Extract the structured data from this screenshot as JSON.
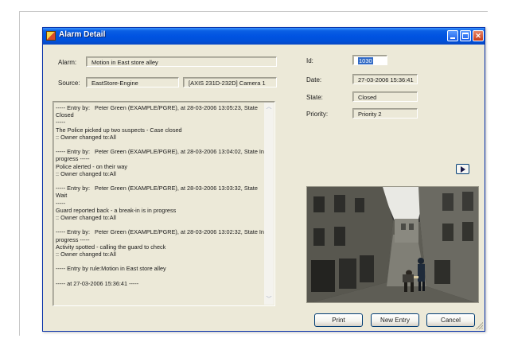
{
  "window": {
    "title": "Alarm Detail"
  },
  "left": {
    "alarm_label": "Alarm:",
    "alarm_value": "Motion in East store alley",
    "source_label": "Source:",
    "source_value": "EastStore-Engine",
    "camera_value": "[AXIS 231D-232D] Camera 1",
    "log_text": "----- Entry by:   Peter Green (EXAMPLE/PGRE), at 28-03-2006 13:05:23, State Closed\n-----\nThe Police picked up two suspects - Case closed\n:: Owner changed to:All\n\n----- Entry by:   Peter Green (EXAMPLE/PGRE), at 28-03-2006 13:04:02, State In\nprogress -----\nPolice alerted - on their way\n:: Owner changed to:All\n\n----- Entry by:   Peter Green (EXAMPLE/PGRE), at 28-03-2006 13:03:32, State Wait\n-----\nGuard reported back - a break-in is in progress\n:: Owner changed to:All\n\n----- Entry by:   Peter Green (EXAMPLE/PGRE), at 28-03-2006 13:02:32, State In\nprogress -----\nActivity spotted - calling the guard to check\n:: Owner changed to:All\n\n----- Entry by rule:Motion in East store alley\n\n----- at 27-03-2006 15:36:41 -----"
  },
  "right": {
    "id_label": "Id:",
    "id_value": "1030",
    "date_label": "Date:",
    "date_value": "27-03-2006 15:36:41",
    "state_label": "State:",
    "state_value": "Closed",
    "priority_label": "Priority:",
    "priority_value": "Priority 2"
  },
  "buttons": {
    "print": "Print",
    "new_entry": "New Entry",
    "cancel": "Cancel"
  },
  "icons": {
    "app": "alarm-app-icon",
    "minimize": "minimize-icon",
    "maximize": "maximize-icon",
    "close": "close-icon",
    "play": "play-icon",
    "scroll_up": "chevron-up-icon",
    "scroll_down": "chevron-down-icon"
  },
  "colors": {
    "titlebar": "#0053e1",
    "window_bg": "#ece9d8",
    "selection": "#316ac5",
    "close_button": "#c83a16"
  }
}
